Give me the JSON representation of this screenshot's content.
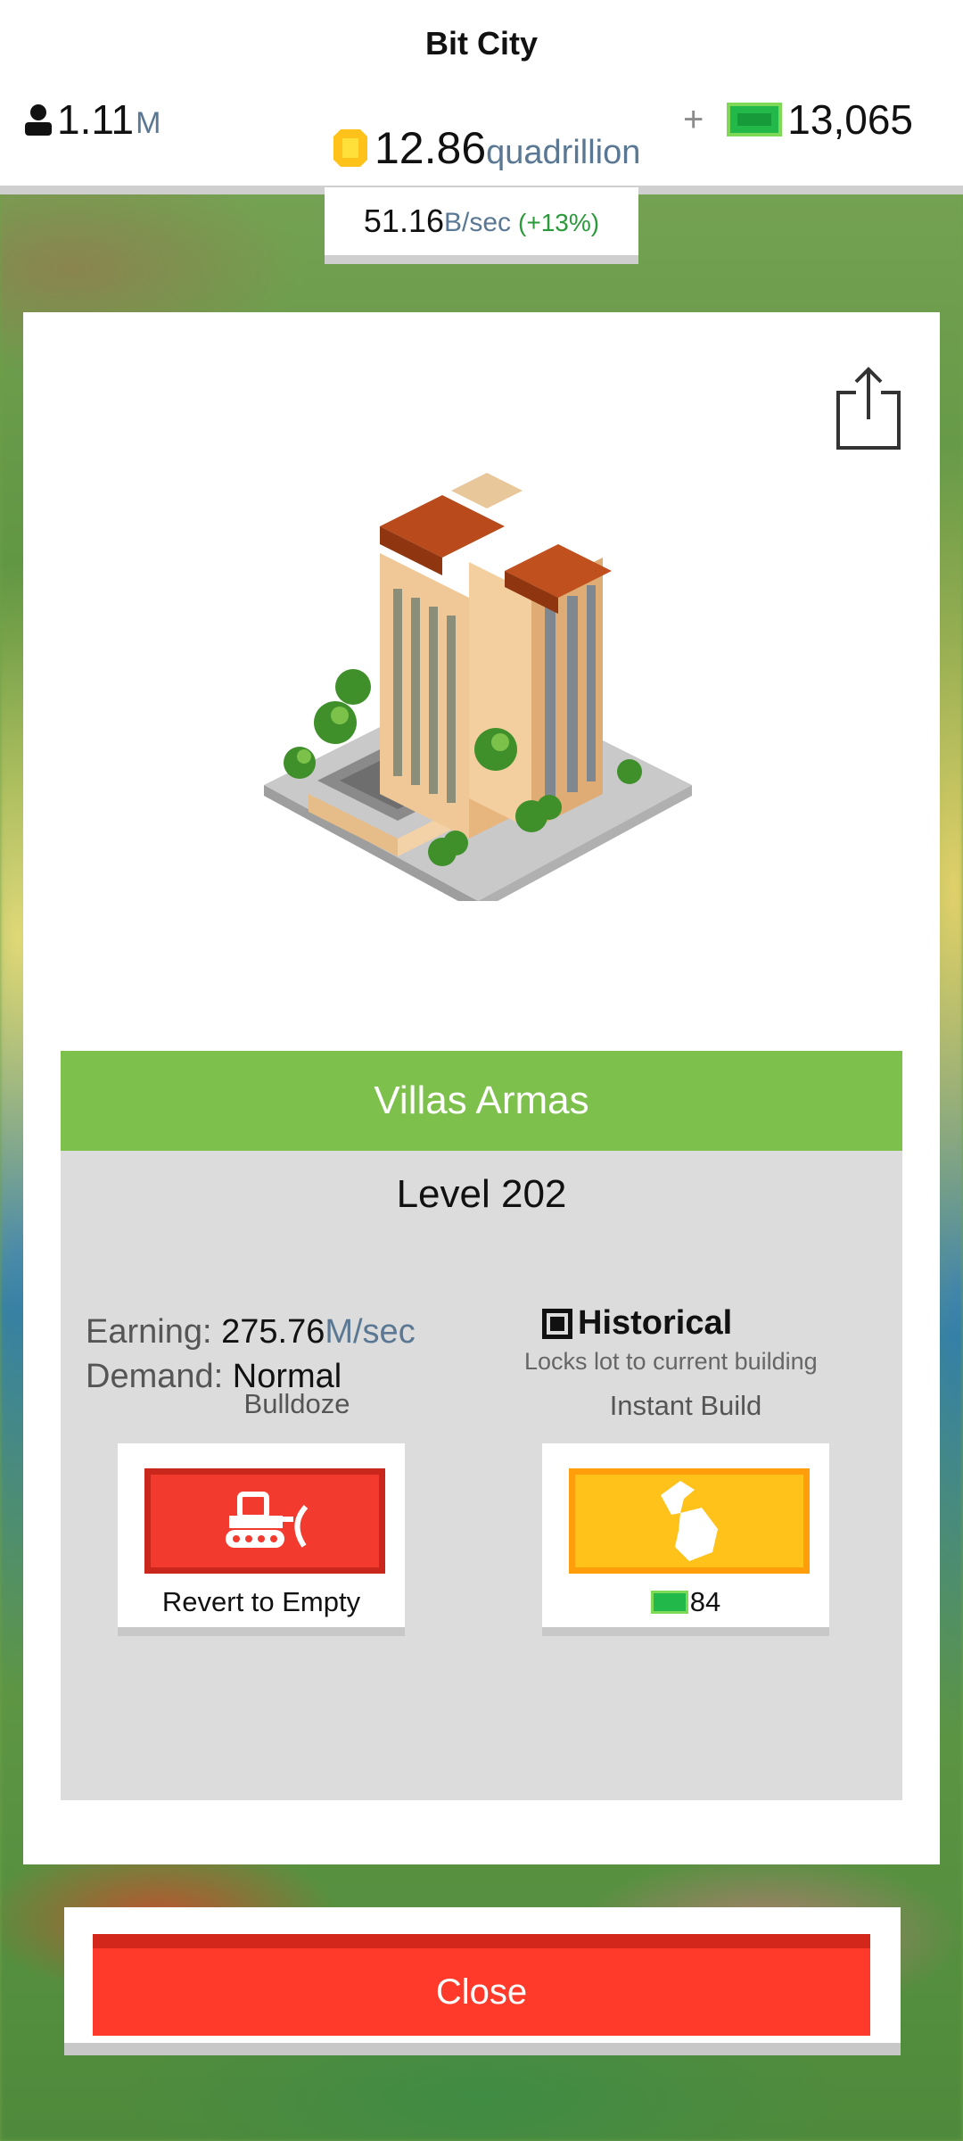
{
  "app": {
    "title": "Bit City"
  },
  "status": {
    "population_value": "1.11",
    "population_unit": "M",
    "coins_value": "12.86",
    "coins_unit": "quadrillion",
    "plus_label": "+",
    "cash_value": "13,065",
    "rate_value": "51.16",
    "rate_unit": "B/sec",
    "rate_change": "(+13%)"
  },
  "building": {
    "name": "Villas Armas",
    "level": "Level 202",
    "earning_label": "Earning:",
    "earning_value": "275.76",
    "earning_unit": "M/sec",
    "demand_label": "Demand:",
    "demand_value": "Normal",
    "historical_title": "Historical",
    "historical_desc": "Locks lot to current building",
    "historical_checked": true
  },
  "actions": {
    "bulldoze_label": "Bulldoze",
    "bulldoze_sub": "Revert to Empty",
    "instant_label": "Instant Build",
    "instant_cost": "84"
  },
  "footer": {
    "close_label": "Close"
  },
  "colors": {
    "name_bar": "#7dc04b",
    "bulldoze": "#f23b2e",
    "instant": "#ffc21a",
    "close": "#ff3a2b",
    "cash_green": "#22b84a"
  },
  "icons": [
    "person-icon",
    "coin-icon",
    "cash-icon",
    "share-icon",
    "bulldozer-icon",
    "hammer-icon",
    "checkbox-icon"
  ]
}
